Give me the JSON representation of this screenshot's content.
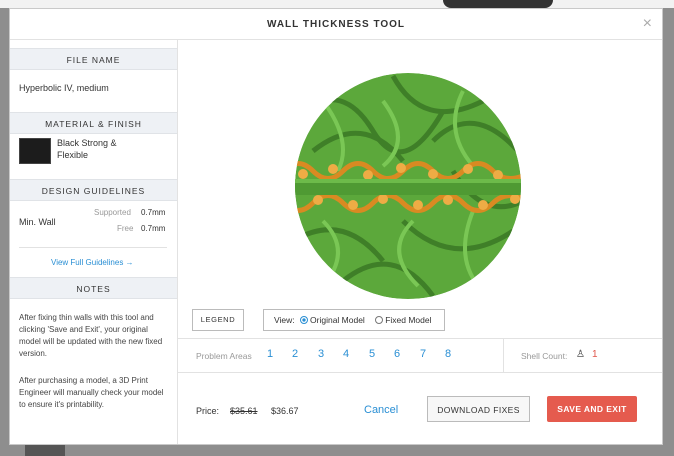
{
  "modal": {
    "title": "WALL THICKNESS TOOL",
    "close_label": "×"
  },
  "sidebar": {
    "file_name_header": "FILE NAME",
    "file_name": "Hyperbolic IV, medium",
    "material_header": "MATERIAL & FINISH",
    "material_line1": "Black Strong &",
    "material_line2": "Flexible",
    "guidelines_header": "DESIGN GUIDELINES",
    "min_wall_label": "Min. Wall",
    "supported_label": "Supported",
    "supported_value": "0.7mm",
    "free_label": "Free",
    "free_value": "0.7mm",
    "full_guidelines_link": "View Full Guidelines →",
    "notes_header": "NOTES",
    "note1": "After fixing thin walls with this tool and clicking 'Save and Exit', your original model will be updated with the new fixed version.",
    "note2": "After purchasing a model, a 3D Print Engineer will manually check your model to ensure it's printability."
  },
  "viewer": {
    "legend_label": "LEGEND",
    "view_label": "View:",
    "original_model_label": "Original Model",
    "fixed_model_label": "Fixed Model",
    "selected_view": "Original Model",
    "model_colors": {
      "ok": "#5aaa3c",
      "thin": "#e6a13a"
    }
  },
  "problems": {
    "label": "Problem Areas",
    "areas": [
      "1",
      "2",
      "3",
      "4",
      "5",
      "6",
      "7",
      "8"
    ],
    "shell_count_label": "Shell Count:",
    "shell_icon": "person-icon",
    "shell_count": "1"
  },
  "footer": {
    "price_label": "Price:",
    "old_price": "$35.61",
    "new_price": "$36.67",
    "cancel_label": "Cancel",
    "download_label": "DOWNLOAD FIXES",
    "save_label": "SAVE AND EXIT"
  },
  "colors": {
    "accent": "#2a8fd4",
    "save_button": "#e55b4e",
    "sidebar_header": "#eef1f5"
  }
}
